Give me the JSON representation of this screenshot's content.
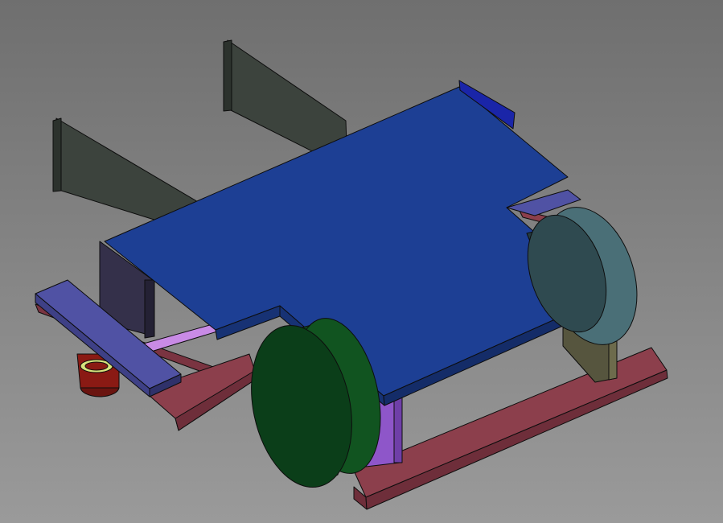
{
  "viewport": {
    "background_top": "#6f6f6f",
    "background_bottom": "#9a9a9a"
  },
  "model": {
    "parts": [
      {
        "name": "rear-left-upright",
        "color": "#3c433d"
      },
      {
        "name": "rear-right-upright",
        "color": "#3c433d"
      },
      {
        "name": "chassis-rails",
        "color": "#8c3f4c"
      },
      {
        "name": "top-deck-plate",
        "color": "#1d3f94"
      },
      {
        "name": "front-bumper-bar",
        "color": "#5052a4"
      },
      {
        "name": "front-caster",
        "color": "#8a1a14"
      },
      {
        "name": "axle-rod",
        "color": "#c98be6"
      },
      {
        "name": "front-wheel",
        "color": "#0b3e19"
      },
      {
        "name": "rear-wheel",
        "color": "#2f4a50"
      },
      {
        "name": "motor-bracket",
        "color": "#56553e"
      },
      {
        "name": "side-bracket",
        "color": "#8e56c9"
      }
    ]
  }
}
